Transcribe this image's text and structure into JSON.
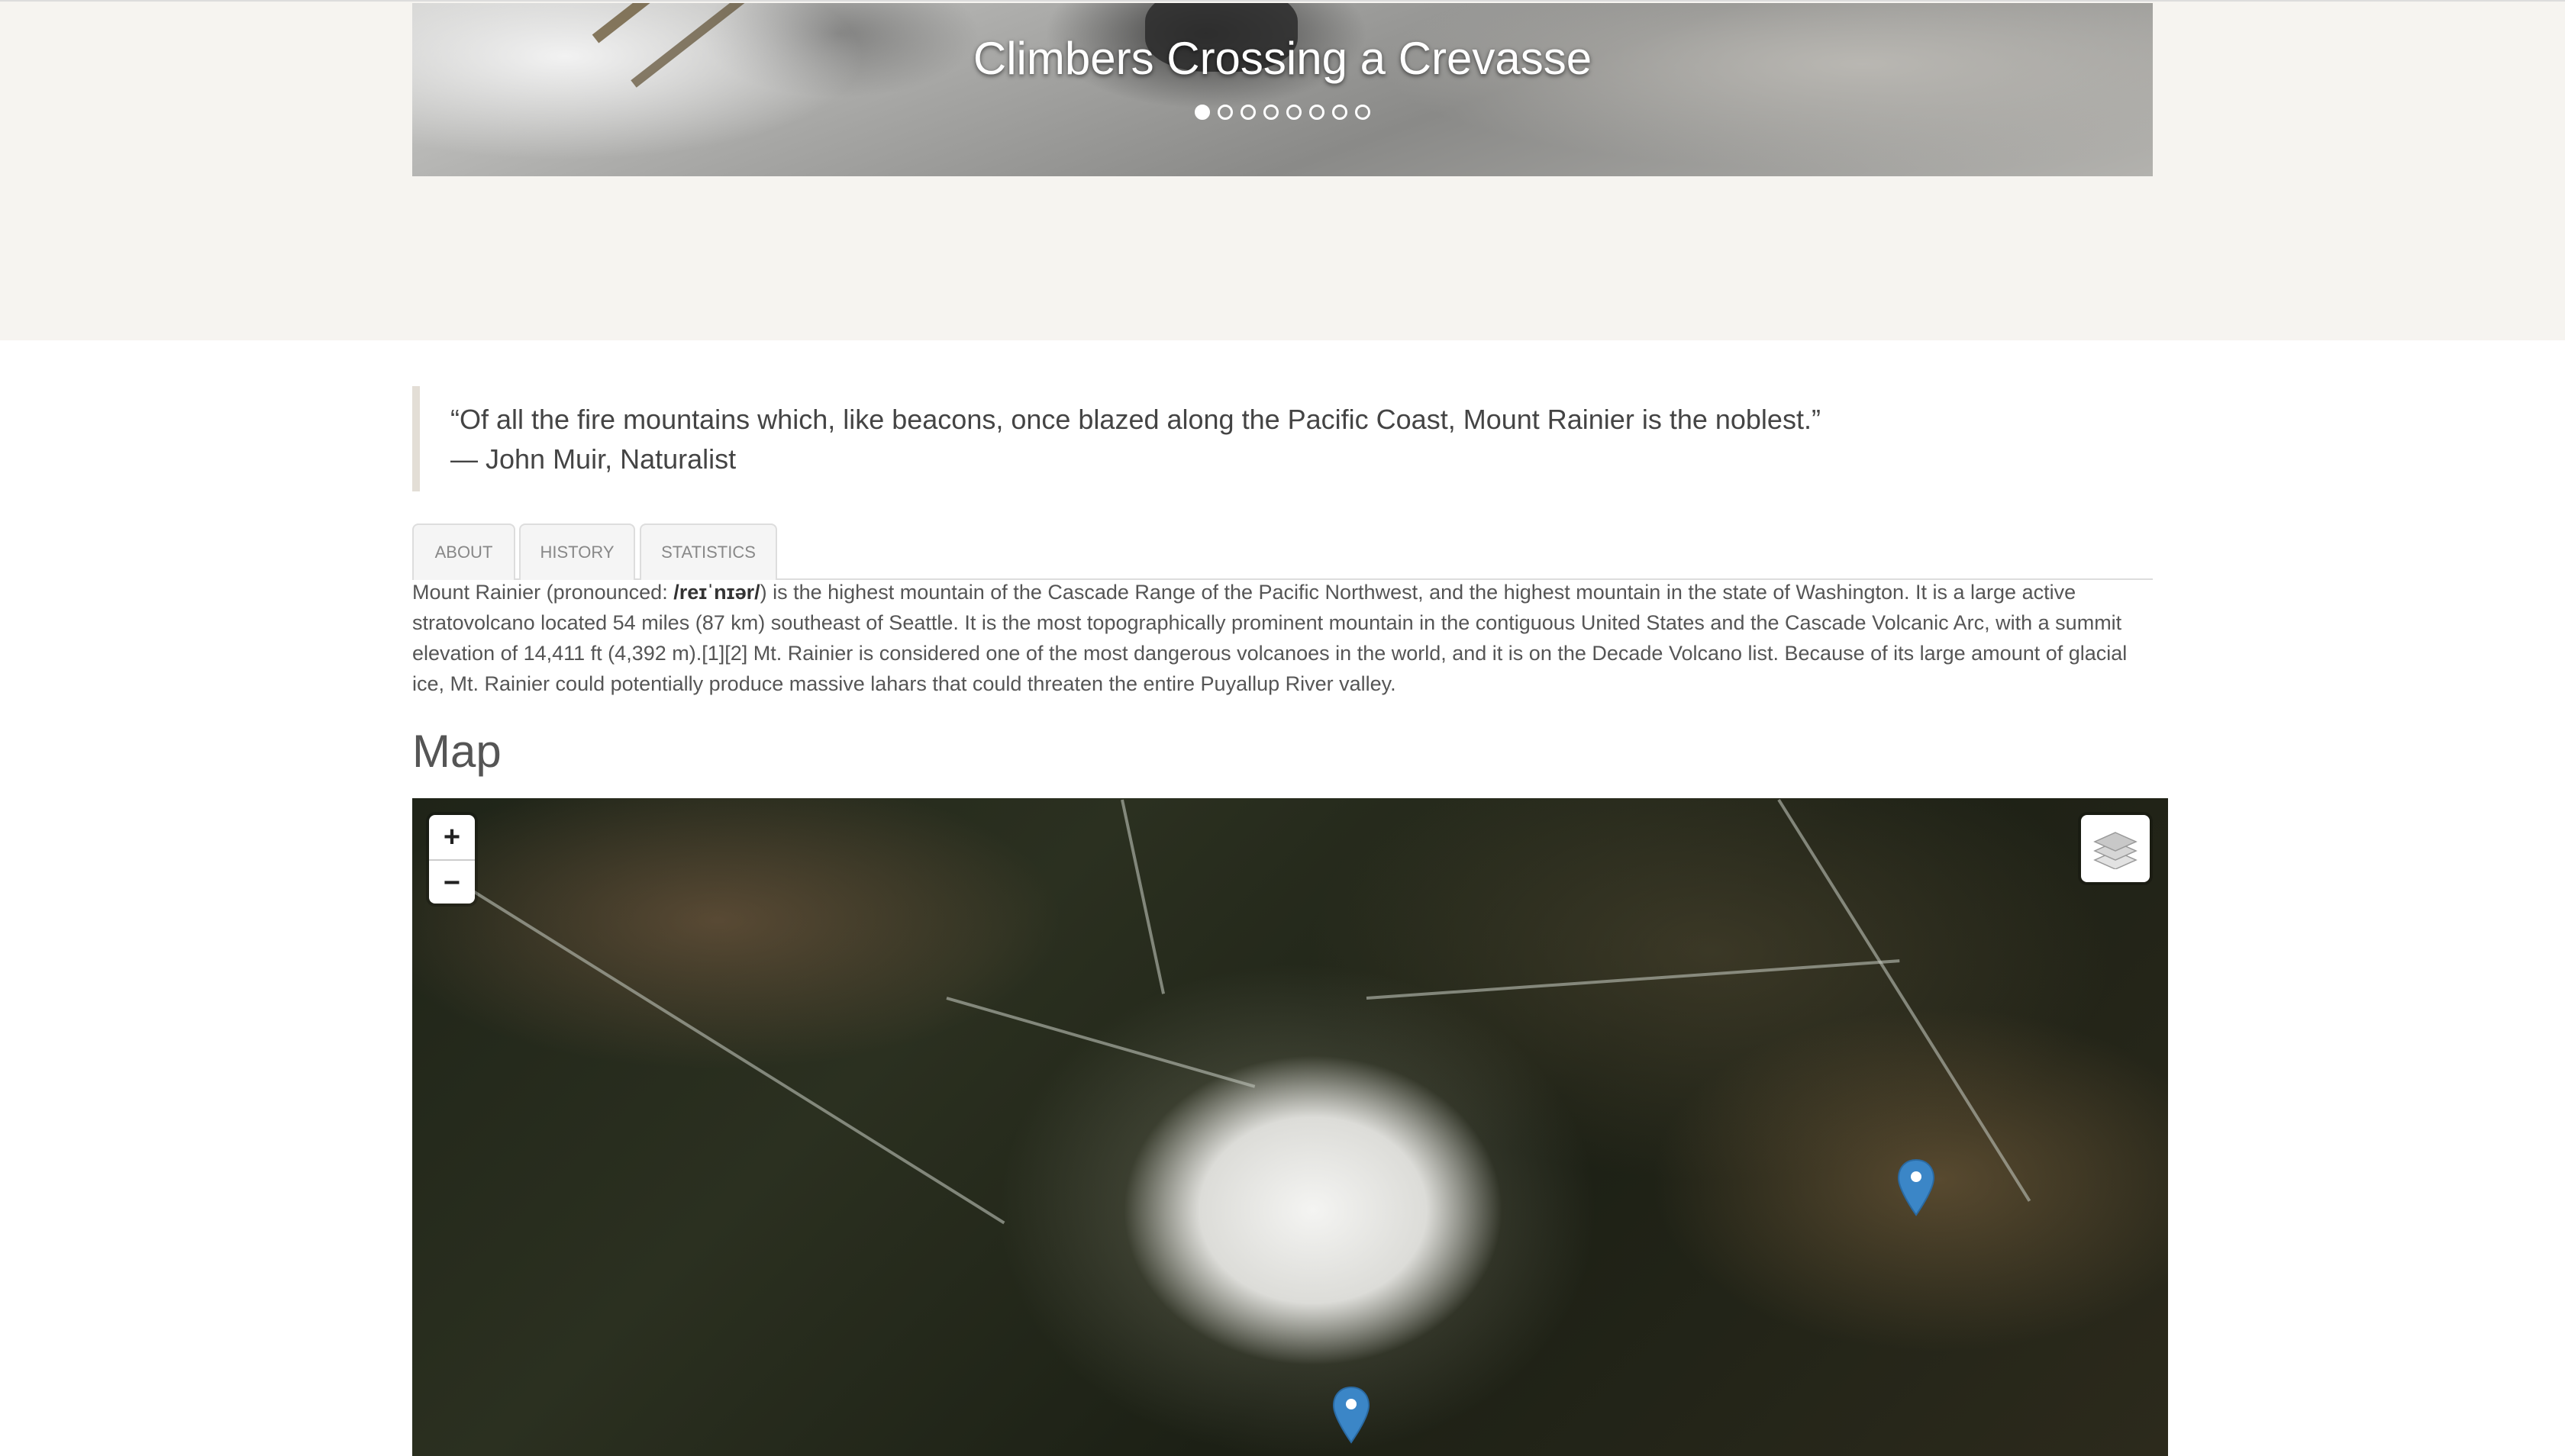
{
  "carousel": {
    "caption": "Climbers Crossing a Crevasse",
    "slide_count": 8,
    "active_index": 0
  },
  "quote": {
    "text": "“Of all the fire mountains which, like beacons, once blazed along the Pacific Coast, Mount Rainier is the noblest.”",
    "attribution": "— John Muir, Naturalist"
  },
  "tabs": [
    {
      "label": "ABOUT"
    },
    {
      "label": "HISTORY"
    },
    {
      "label": "STATISTICS"
    }
  ],
  "about": {
    "prefix": "Mount Rainier (pronounced: ",
    "pronunciation": "/reɪˈnɪər/",
    "body": ") is the highest mountain of the Cascade Range of the Pacific Northwest, and the highest mountain in the state of Washington. It is a large active stratovolcano located 54 miles (87 km) southeast of Seattle. It is the most topographically prominent mountain in the contiguous United States and the Cascade Volcanic Arc, with a summit elevation of 14,411 ft (4,392 m).[1][2] Mt. Rainier is considered one of the most dangerous volcanoes in the world, and it is on the Decade Volcano list. Because of its large amount of glacial ice, Mt. Rainier could potentially produce massive lahars that could threaten the entire Puyallup River valley."
  },
  "map": {
    "title": "Map",
    "zoom_in_label": "+",
    "zoom_out_label": "−",
    "layers_icon": "layers-icon",
    "marker_icon": "map-marker-icon",
    "marker_color": "#3b86c7"
  }
}
